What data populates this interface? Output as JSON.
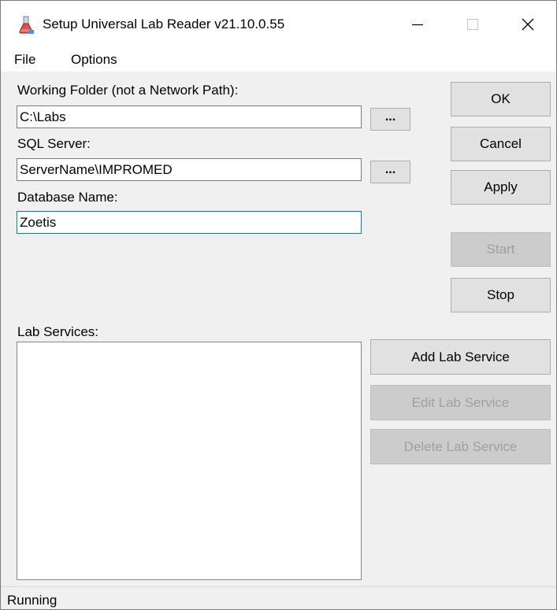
{
  "window": {
    "title": "Setup Universal Lab Reader v21.10.0.55",
    "icon": "flask-icon"
  },
  "menu": {
    "file": "File",
    "options": "Options"
  },
  "form": {
    "working_folder_label": "Working Folder (not a Network Path):",
    "working_folder_value": "C:\\Labs",
    "browse_label": "...",
    "sql_server_label": "SQL Server:",
    "sql_server_value": "ServerName\\IMPROMED",
    "database_name_label": "Database Name:",
    "database_name_value": "Zoetis",
    "lab_services_label": "Lab Services:",
    "lab_services_items": []
  },
  "buttons": {
    "ok": "OK",
    "cancel": "Cancel",
    "apply": "Apply",
    "start": "Start",
    "stop": "Stop",
    "add_lab_service": "Add Lab Service",
    "edit_lab_service": "Edit Lab Service",
    "delete_lab_service": "Delete Lab Service"
  },
  "status": {
    "text": "Running"
  },
  "colors": {
    "focus_border": "#0078d7",
    "button_face": "#e1e1e1",
    "disabled_face": "#cccccc",
    "disabled_text": "#a0a0a0"
  }
}
